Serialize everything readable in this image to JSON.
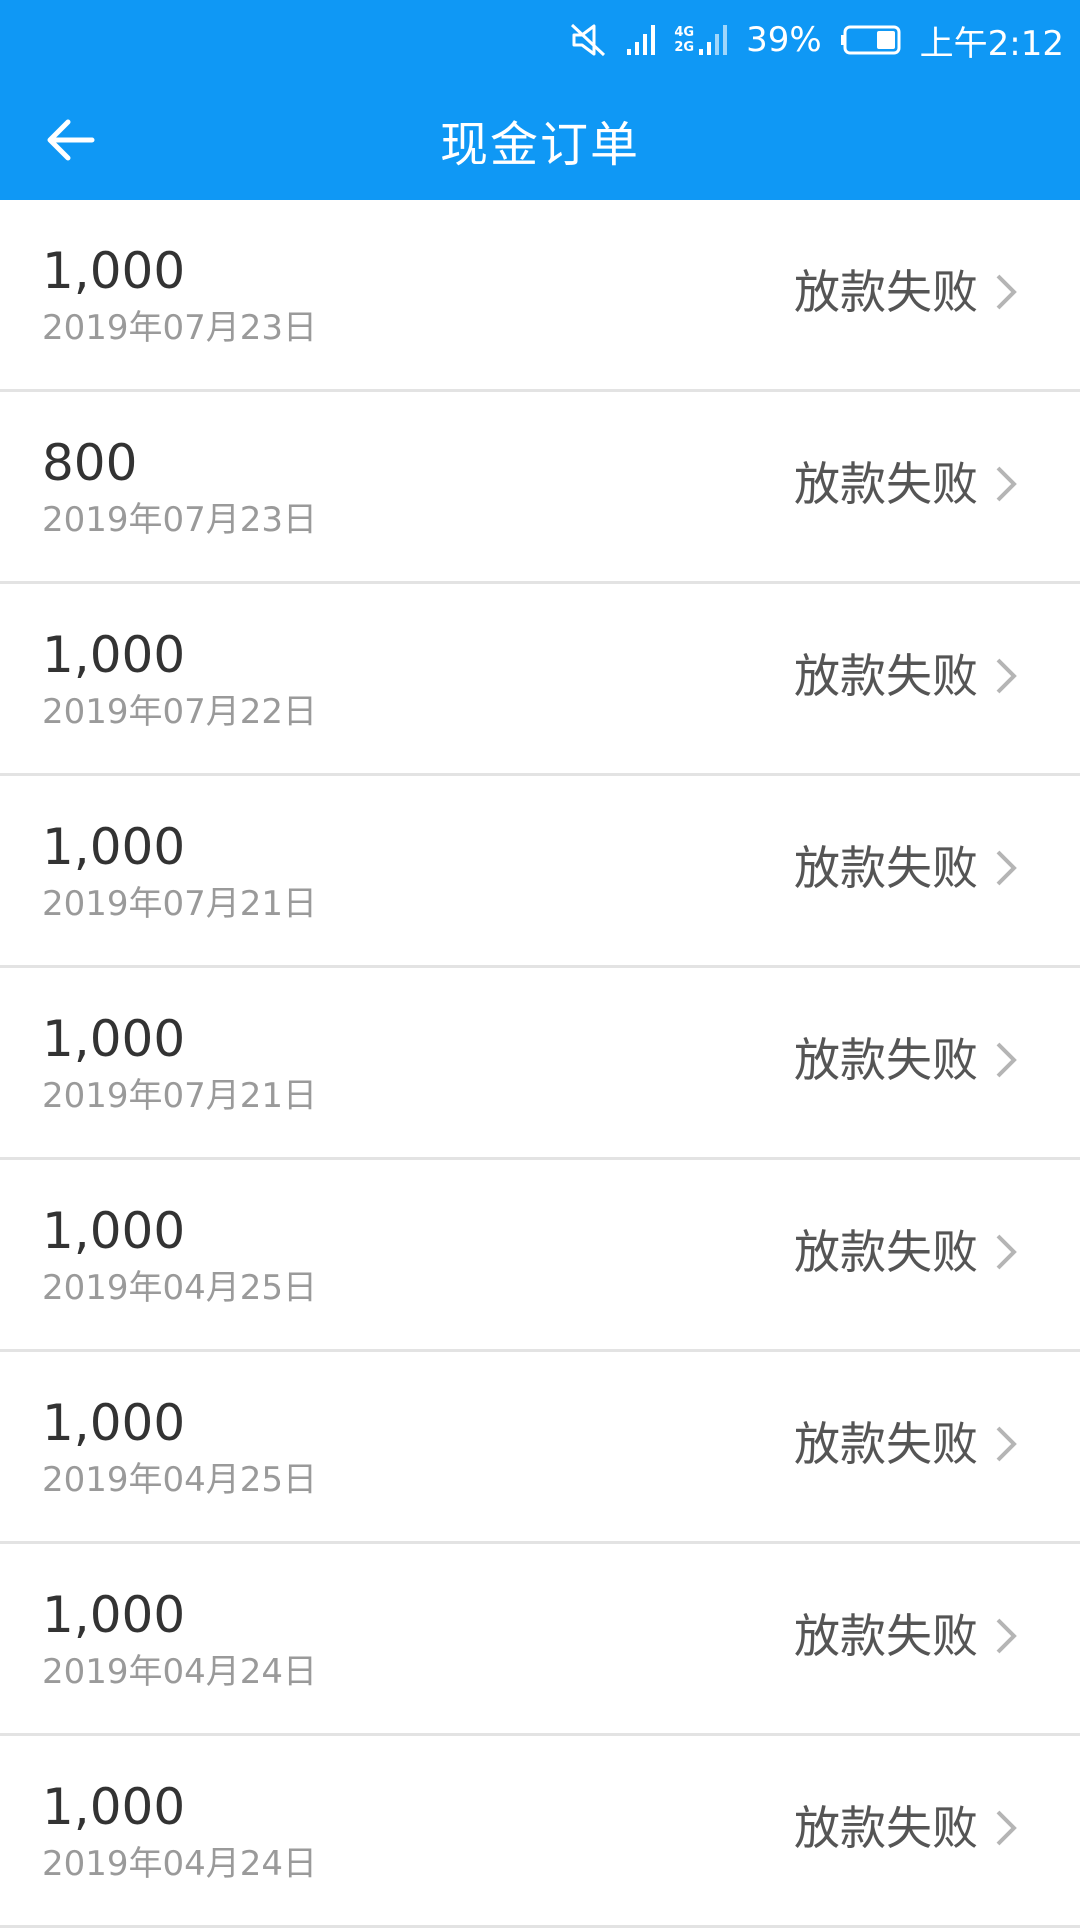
{
  "status_bar": {
    "net_top": "4G",
    "net_bottom": "2G",
    "battery": "39%",
    "time": "上午2:12",
    "icons": [
      "mute-icon",
      "signal-icon",
      "network-signal-icon",
      "battery-icon"
    ]
  },
  "header": {
    "title": "现金订单",
    "back_icon": "arrow-left-icon",
    "color": "#0f98f5"
  },
  "orders": [
    {
      "amount": "1,000",
      "date": "2019年07月23日",
      "status": "放款失败"
    },
    {
      "amount": "800",
      "date": "2019年07月23日",
      "status": "放款失败"
    },
    {
      "amount": "1,000",
      "date": "2019年07月22日",
      "status": "放款失败"
    },
    {
      "amount": "1,000",
      "date": "2019年07月21日",
      "status": "放款失败"
    },
    {
      "amount": "1,000",
      "date": "2019年07月21日",
      "status": "放款失败"
    },
    {
      "amount": "1,000",
      "date": "2019年04月25日",
      "status": "放款失败"
    },
    {
      "amount": "1,000",
      "date": "2019年04月25日",
      "status": "放款失败"
    },
    {
      "amount": "1,000",
      "date": "2019年04月24日",
      "status": "放款失败"
    },
    {
      "amount": "1,000",
      "date": "2019年04月24日",
      "status": "放款失败"
    }
  ]
}
